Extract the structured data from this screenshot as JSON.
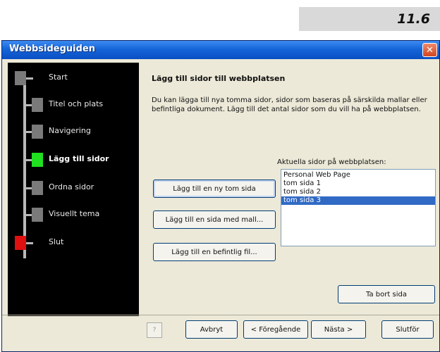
{
  "page_number": "11.6",
  "window": {
    "title": "Webbsideguiden",
    "close_glyph": "✕"
  },
  "nav": {
    "steps": [
      {
        "label": "Start",
        "state": "normal"
      },
      {
        "label": "Titel och plats",
        "state": "normal"
      },
      {
        "label": "Navigering",
        "state": "normal"
      },
      {
        "label": "Lägg till sidor",
        "state": "active"
      },
      {
        "label": "Ordna sidor",
        "state": "normal"
      },
      {
        "label": "Visuellt tema",
        "state": "normal"
      },
      {
        "label": "Slut",
        "state": "end"
      }
    ]
  },
  "content": {
    "heading": "Lägg till sidor till webbplatsen",
    "description": "Du kan lägga till nya tomma sidor, sidor som baseras på särskilda mallar eller befintliga dokument. Lägg till det antal sidor som du vill ha på webbplatsen.",
    "list_label": "Aktuella sidor på webbplatsen:",
    "buttons": {
      "add_blank": "Lägg till en ny tom sida",
      "add_template": "Lägg till en sida med mall...",
      "add_existing": "Lägg till en befintlig fil...",
      "remove": "Ta bort sida"
    },
    "pages": [
      {
        "label": "Personal Web Page",
        "selected": false
      },
      {
        "label": "tom sida 1",
        "selected": false
      },
      {
        "label": "tom sida 2",
        "selected": false
      },
      {
        "label": "tom sida 3",
        "selected": true
      }
    ]
  },
  "footer": {
    "help_icon": "help-icon",
    "cancel": "Avbryt",
    "back": "< Föregående",
    "next": "Nästa >",
    "finish": "Slutför"
  }
}
